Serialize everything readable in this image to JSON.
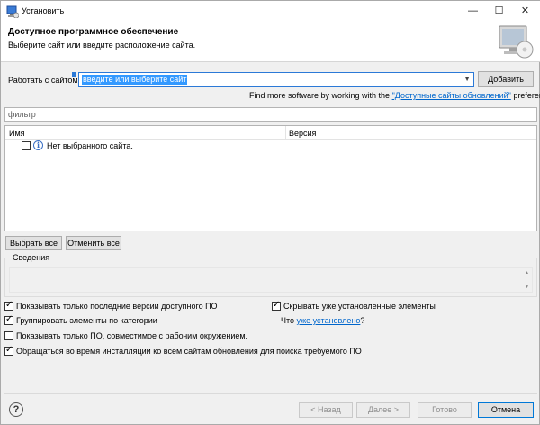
{
  "window": {
    "title": "Установить",
    "minimize": "—",
    "maximize": "☐",
    "close": "✕"
  },
  "banner": {
    "title": "Доступное программное обеспечение",
    "description": "Выберите сайт или введите расположение сайта."
  },
  "site": {
    "label": "Работать с сайтом:",
    "combo_value": "введите или выберите сайт",
    "add_button": "Добавить",
    "find_more_prefix": "Find more software by working with the ",
    "find_more_link": "\"Доступные сайты обновлений\"",
    "find_more_suffix": " preferences."
  },
  "filter": {
    "placeholder": "фильтр"
  },
  "tree": {
    "columns": [
      "Имя",
      "Версия"
    ],
    "rows": [
      {
        "checked": false,
        "icon": "info-icon",
        "name": "Нет выбранного сайта."
      }
    ]
  },
  "selection_buttons": {
    "select_all": "Выбрать все",
    "deselect_all": "Отменить все"
  },
  "details": {
    "label": "Сведения"
  },
  "options": {
    "show_latest": {
      "label": "Показывать только последние версии доступного ПО",
      "checked": true
    },
    "hide_installed": {
      "label": "Скрывать уже установленные элементы",
      "checked": true
    },
    "group_by_category": {
      "label": "Группировать элементы по категории",
      "checked": true
    },
    "whats_installed_prefix": "Что ",
    "whats_installed_link": "уже установлено",
    "whats_installed_suffix": "?",
    "show_compatible": {
      "label": "Показывать только ПО, совместимое с рабочим окружением.",
      "checked": false
    },
    "contact_all_sites": {
      "label": "Обращаться во время инсталляции ко всем сайтам обновления для поиска требуемого ПО",
      "checked": true
    }
  },
  "footer": {
    "back": "< Назад",
    "next": "Далее >",
    "finish": "Готово",
    "cancel": "Отмена"
  }
}
